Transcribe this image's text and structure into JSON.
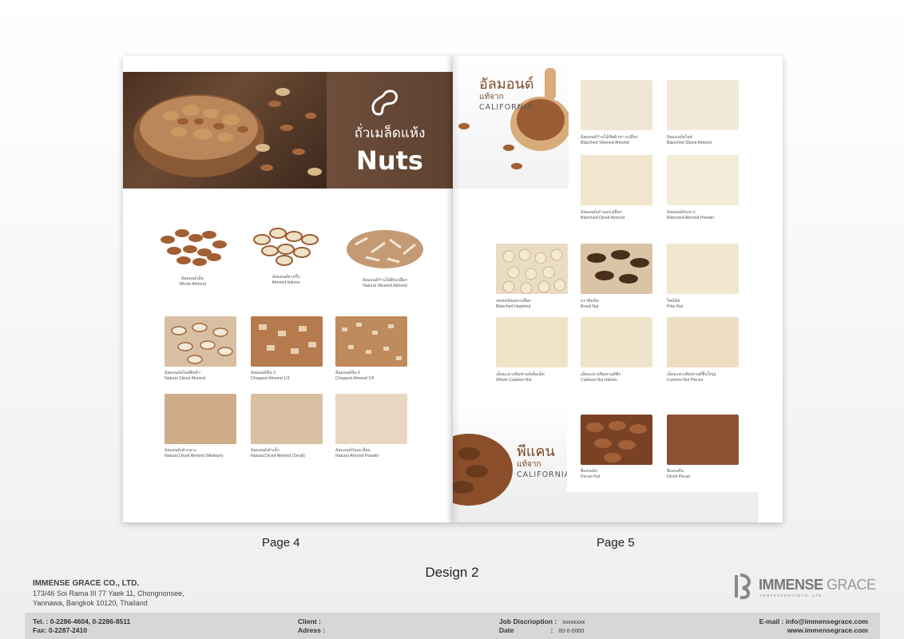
{
  "page4": {
    "banner": {
      "title_th": "ถั่วเมล็ดแห้ง",
      "title_en": "Nuts"
    },
    "products": [
      {
        "th": "อัลมอนด์เม็ด",
        "en": "Whole Almond"
      },
      {
        "th": "อัลมอนด์ผ่าครึ่ง",
        "en": "Almond Halves"
      },
      {
        "th": "อัลมอนด์ก้านไม้ติดเปลือก",
        "en": "Natural Slivered Almond"
      },
      {
        "th": "อัลมอนด์สไลด์ติดผิว",
        "en": "Natural Sliced Almond"
      },
      {
        "th": "อัลมอนด์หั่น 3",
        "en": "Chopped Almond 1/3"
      },
      {
        "th": "อัลมอนด์หั่น 6",
        "en": "Chopped Almond 1/6"
      },
      {
        "th": "อัลมอนด์เต๋ากลาง",
        "en": "Natural Diced Almond (Medium)"
      },
      {
        "th": "อัลมอนด์เต๋าเล็ก",
        "en": "Natural Diced Almond (Small)"
      },
      {
        "th": "อัลมอนด์ป่นละเอียด",
        "en": "Natural Almond Powder"
      }
    ]
  },
  "page5": {
    "almond_section": {
      "th": "อัลมอนด์",
      "th2": "แท้จาก",
      "en": "CALIFORNIA"
    },
    "pecan_section": {
      "th": "พีแคน",
      "th2": "แท้จาก",
      "en": "CALIFORNIA"
    },
    "products": [
      {
        "th": "อัลมอนด์ก้านไม้ขัดผิวขาวเปลือก",
        "en": "Blanched Slivered Almond"
      },
      {
        "th": "อัลมอนด์สไลด์",
        "en": "Blanched Sliced Almond"
      },
      {
        "th": "อัลมอนด์เต๋าลอกเปลือก",
        "en": "Blanched Diced Almond"
      },
      {
        "th": "อัลมอนด์ป่นขาว",
        "en": "Blanched Almond Powder"
      },
      {
        "th": "เฮเซลนัทลอกเปลือก",
        "en": "Blanched Hazelnut"
      },
      {
        "th": "บราซิลนัท",
        "en": "Brazil Nut"
      },
      {
        "th": "ไพน์นัท",
        "en": "Pine Nut"
      },
      {
        "th": "เม็ดมะม่วงหิมพานต์เต็มเม็ด",
        "en": "Whole Cashew Nut"
      },
      {
        "th": "เม็ดมะม่วงหิมพานต์ซีก",
        "en": "Cashew Nut Halves"
      },
      {
        "th": "เม็ดมะม่วงหิมพานต์ชิ้นใหญ่",
        "en": "Cashew Nut Pieces"
      },
      {
        "th": "พีแคนนัท",
        "en": "Pecan Nut"
      },
      {
        "th": "พีแคนหั่น",
        "en": "Diced Pecan"
      }
    ]
  },
  "labels": {
    "page4": "Page 4",
    "page5": "Page 5",
    "design": "Design 2"
  },
  "company": {
    "name": "IMMENSE GRACE CO., LTD.",
    "address1": "173/46 Soi Rama III 77 Yaek 11, Chongnonsee,",
    "address2": "Yannawa, Bangkok 10120,  Thailand"
  },
  "logo": {
    "text1": "IMM",
    "text2": "ENSE",
    "text3": "GRACE",
    "sub": "I M M E N S E   G R A C E   C O . ,   L T D ."
  },
  "footer": {
    "tel_label": "Tel. :",
    "tel": "0-2286-4604, 0-2286-8511",
    "fax_label": "Fax:",
    "fax": "0-2287-2410",
    "client_label": "Client   :",
    "client": "",
    "address_label": "Adress :",
    "address": "",
    "job_label": "Job Discrioption :",
    "job": "xxxxxxxx",
    "date_label": "Date",
    "date_colon": ":",
    "date": "00-0-0000",
    "email_label": "E-mail :",
    "email": "info@immensegrace.com",
    "website": "www.immensegrace.com"
  },
  "colors": {
    "banner_brown": "#6e4d3a",
    "section_brown": "#7a4a26",
    "footer_bar": "#d7d7d7"
  }
}
